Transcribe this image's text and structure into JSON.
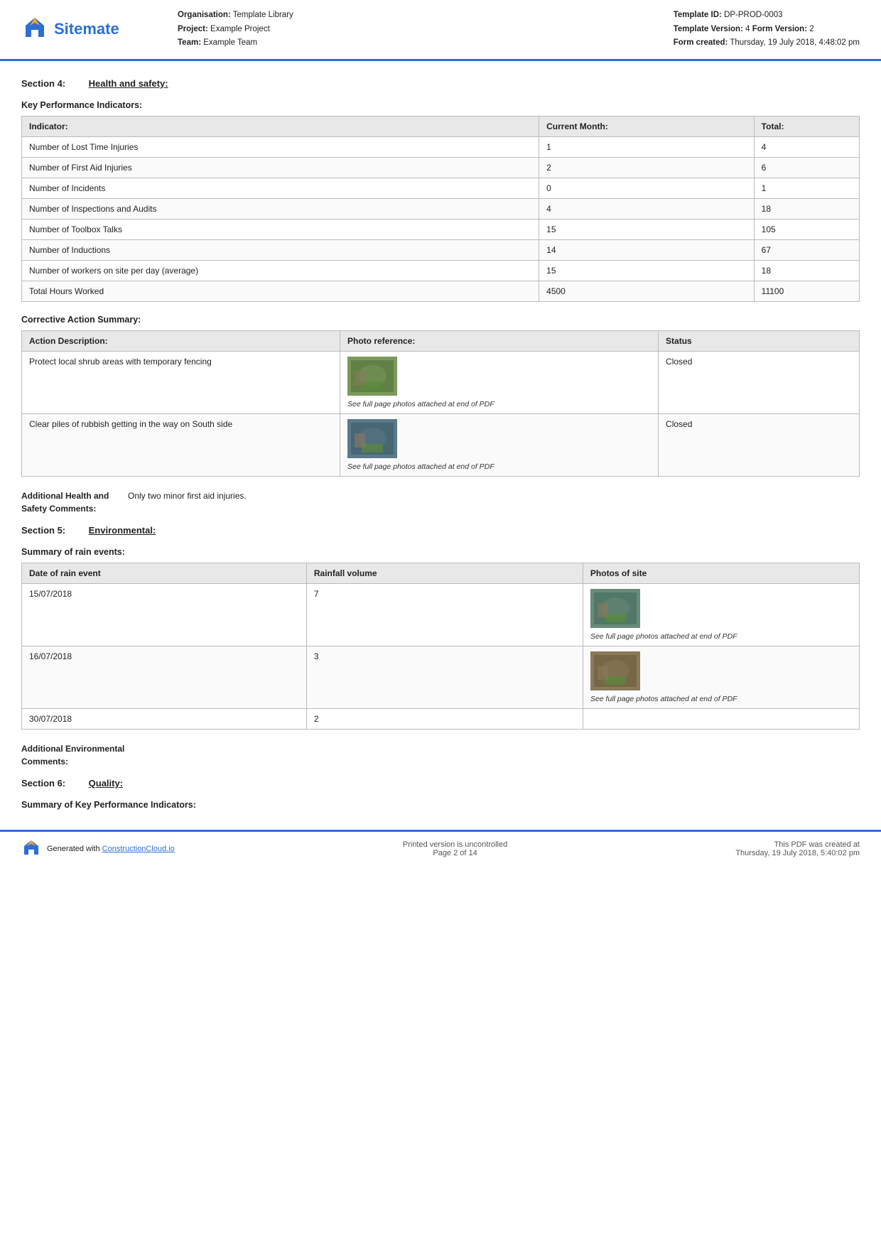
{
  "header": {
    "logo_text": "Sitemate",
    "org_label": "Organisation:",
    "org_value": "Template Library",
    "project_label": "Project:",
    "project_value": "Example Project",
    "team_label": "Team:",
    "team_value": "Example Team",
    "template_id_label": "Template ID:",
    "template_id_value": "DP-PROD-0003",
    "template_version_label": "Template Version:",
    "template_version_value": "4",
    "form_version_label": "Form Version:",
    "form_version_value": "2",
    "form_created_label": "Form created:",
    "form_created_value": "Thursday, 19 July 2018, 4:48:02 pm"
  },
  "section4": {
    "number": "Section 4:",
    "title": "Health and safety:",
    "kpi_heading": "Key Performance Indicators:",
    "kpi_columns": [
      "Indicator:",
      "Current Month:",
      "Total:"
    ],
    "kpi_rows": [
      [
        "Number of Lost Time Injuries",
        "1",
        "4"
      ],
      [
        "Number of First Aid Injuries",
        "2",
        "6"
      ],
      [
        "Number of Incidents",
        "0",
        "1"
      ],
      [
        "Number of Inspections and Audits",
        "4",
        "18"
      ],
      [
        "Number of Toolbox Talks",
        "15",
        "105"
      ],
      [
        "Number of Inductions",
        "14",
        "67"
      ],
      [
        "Number of workers on site per day (average)",
        "15",
        "18"
      ],
      [
        "Total Hours Worked",
        "4500",
        "11100"
      ]
    ],
    "corrective_heading": "Corrective Action Summary:",
    "corrective_columns": [
      "Action Description:",
      "Photo reference:",
      "Status"
    ],
    "corrective_rows": [
      {
        "description": "Protect local shrub areas with temporary fencing",
        "photo_caption": "See full page photos attached at end of PDF",
        "status": "Closed"
      },
      {
        "description": "Clear piles of rubbish getting in the way on South side",
        "photo_caption": "See full page photos attached at end of PDF",
        "status": "Closed"
      }
    ],
    "additional_label": "Additional Health and Safety Comments:",
    "additional_value": "Only two minor first aid injuries."
  },
  "section5": {
    "number": "Section 5:",
    "title": "Environmental:",
    "rain_heading": "Summary of rain events:",
    "rain_columns": [
      "Date of rain event",
      "Rainfall volume",
      "Photos of site"
    ],
    "rain_rows": [
      {
        "date": "15/07/2018",
        "volume": "7",
        "photo_caption": "See full page photos attached at end of PDF"
      },
      {
        "date": "16/07/2018",
        "volume": "3",
        "photo_caption": "See full page photos attached at end of PDF"
      },
      {
        "date": "30/07/2018",
        "volume": "2",
        "photo_caption": ""
      }
    ],
    "additional_label": "Additional Environmental Comments:",
    "additional_value": ""
  },
  "section6": {
    "number": "Section 6:",
    "title": "Quality:",
    "kpi_heading": "Summary of Key Performance Indicators:"
  },
  "footer": {
    "generated_text": "Generated with",
    "link_text": "ConstructionCloud.io",
    "uncontrolled_text": "Printed version is uncontrolled",
    "page_text": "Page 2 of 14",
    "created_text": "This PDF was created at",
    "created_date": "Thursday, 19 July 2018, 5:40:02 pm"
  }
}
